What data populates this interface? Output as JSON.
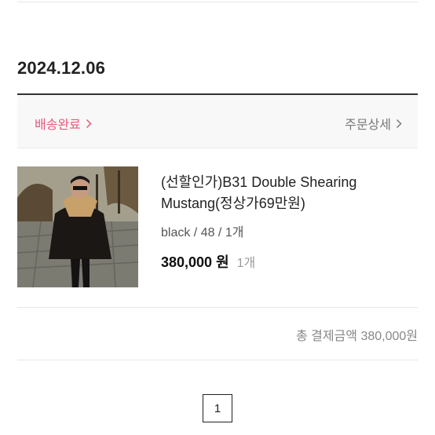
{
  "order": {
    "date": "2024.12.06",
    "status_label": "배송완료",
    "detail_link": "주문상세"
  },
  "product": {
    "image_icon": "product-photo-leather-jacket",
    "name": "(선할인가)B31 Double Shearing Mustang(정상가69만원)",
    "option": "black / 48 / 1개",
    "price": "380,000 원",
    "quantity": "1개"
  },
  "summary": {
    "total": "총 결제금액 380,000원"
  },
  "pagination": {
    "current_page": "1"
  },
  "colors": {
    "status_accent": "#e65a7a",
    "status_background": "#f8f8f8"
  }
}
